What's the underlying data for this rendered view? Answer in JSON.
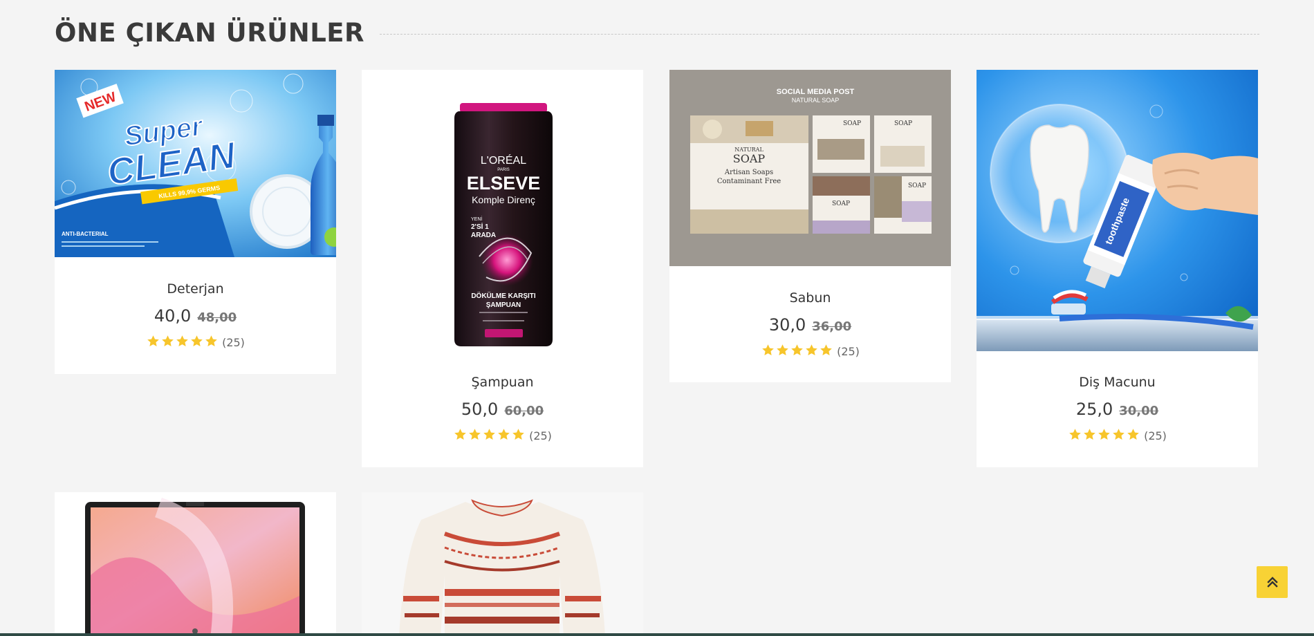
{
  "section": {
    "title": "ÖNE ÇIKAN ÜRÜNLER"
  },
  "thumb_texts": {
    "deterjan": {
      "badge": "NEW",
      "brand_line1": "Super",
      "brand_line2": "CLEAN",
      "banner": "KILLS 99,9% GERMS",
      "footnote": "ANTI-BACTERIAL"
    },
    "sampuan": {
      "brand": "L'ORÉAL",
      "sub": "PARIS",
      "name": "ELSEVE",
      "line": "Komple Direnç",
      "promo_1": "YENİ",
      "promo_2": "2'Sİ 1",
      "promo_3": "ARADA",
      "bottom_1": "DÖKÜLME KARŞITI",
      "bottom_2": "ŞAMPUAN"
    },
    "sabun": {
      "header_1": "SOCIAL MEDIA POST",
      "header_2": "NATURAL SOAP",
      "main_1": "NATURAL",
      "main_2": "SOAP",
      "main_3": "Artisan Soaps",
      "main_4": "Contaminant Free",
      "tile": "SOAP"
    },
    "dis_macunu": {
      "tube": "toothpaste"
    }
  },
  "products": [
    {
      "name": "Deterjan",
      "price": "40,0",
      "old_price": "48,00",
      "rating": 5,
      "rating_count": "(25)"
    },
    {
      "name": "Şampuan",
      "price": "50,0",
      "old_price": "60,00",
      "rating": 5,
      "rating_count": "(25)"
    },
    {
      "name": "Sabun",
      "price": "30,0",
      "old_price": "36,00",
      "rating": 5,
      "rating_count": "(25)"
    },
    {
      "name": "Diş Macunu",
      "price": "25,0",
      "old_price": "30,00",
      "rating": 5,
      "rating_count": "(25)"
    },
    {
      "name": "Laptop",
      "image": "laptop"
    },
    {
      "name": "Kazak",
      "image": "sweater"
    }
  ],
  "colors": {
    "star": "#f7c52b",
    "scroll_button": "#f8d235",
    "background": "#f4f4f4",
    "card": "#ffffff"
  },
  "icons": {
    "star": "star-icon",
    "scroll_top": "double-chevron-up-icon"
  }
}
